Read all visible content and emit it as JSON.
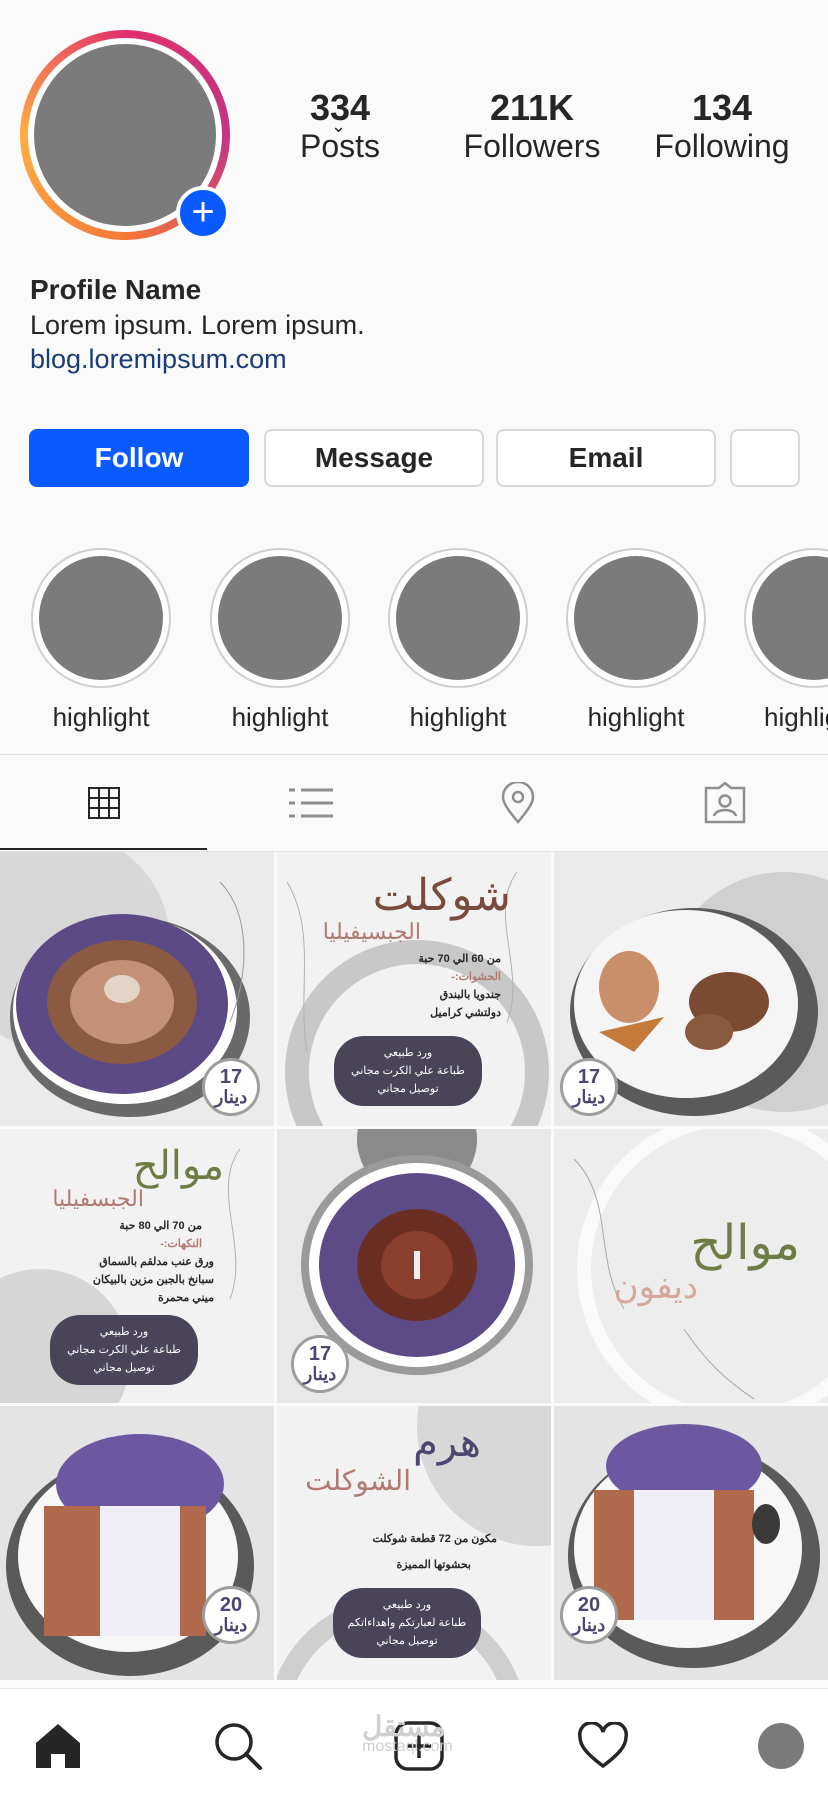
{
  "profile": {
    "name": "Profile Name",
    "bio": "Lorem ipsum. Lorem ipsum.",
    "link": "blog.loremipsum.com"
  },
  "stats": [
    {
      "value": "334",
      "label": "Posts"
    },
    {
      "value": "211K",
      "label": "Followers"
    },
    {
      "value": "134",
      "label": "Following"
    }
  ],
  "actions": {
    "follow": "Follow",
    "message": "Message",
    "email": "Email"
  },
  "highlights": [
    "highlight",
    "highlight",
    "highlight",
    "highlight",
    "highlight"
  ],
  "tabs": [
    "grid-icon",
    "list-icon",
    "location-pin-icon",
    "tagged-person-icon"
  ],
  "colors": {
    "accent": "#0a5bff",
    "price_text": "#4e4670",
    "title_green": "#6e7d45",
    "title_rose": "#b07a72",
    "title_brown": "#7a4b3c"
  },
  "posts": {
    "p1": {
      "price": "17",
      "currency": "دينار"
    },
    "p2": {
      "title": "شوكلت",
      "subtitle": "الجبسيفيليا",
      "line1": "من 60 الي 70 حبة",
      "line2": "الحشوات:-",
      "line3": "جندويا بالبندق",
      "line4": "دولتشي كراميل",
      "badge1": "ورد طبيعي",
      "badge2": "طباعة علي الكرت مجاني",
      "badge3": "توصيل مجاني"
    },
    "p3": {
      "price": "17",
      "currency": "دينار"
    },
    "p4": {
      "title": "موالح",
      "subtitle": "الجبسفيليا",
      "line1": "من 70 الي 80 حبة",
      "line2": "النكهات:-",
      "line3": "ورق عنب مدلقم بالسماق",
      "line4": "سبانخ بالجبن مزين بالبيكان",
      "line5": "ميني محمرة",
      "badge1": "ورد طبيعي",
      "badge2": "طباعة علي الكرت مجاني",
      "badge3": "توصيل مجاني"
    },
    "p5": {
      "price": "17",
      "currency": "دينار"
    },
    "p6": {
      "title": "موالح",
      "subtitle": "ديفون"
    },
    "p7": {
      "price": "20",
      "currency": "دينار"
    },
    "p8": {
      "title": "هرم",
      "subtitle": "الشوكلت",
      "line1": "مكون من 72 قطعة شوكلت",
      "line2": "بحشوتها المميزة",
      "badge1": "ورد طبيعي",
      "badge2": "طباعة لعبارتكم واهداءاتكم",
      "badge3": "توصيل مجاني"
    },
    "p9": {
      "price": "20",
      "currency": "دينار"
    }
  },
  "watermark": {
    "ar": "مستقل",
    "en": "mostaql.com"
  },
  "nav": [
    "home-icon",
    "search-icon",
    "new-post-icon",
    "activity-heart-icon",
    "profile-avatar-icon"
  ]
}
